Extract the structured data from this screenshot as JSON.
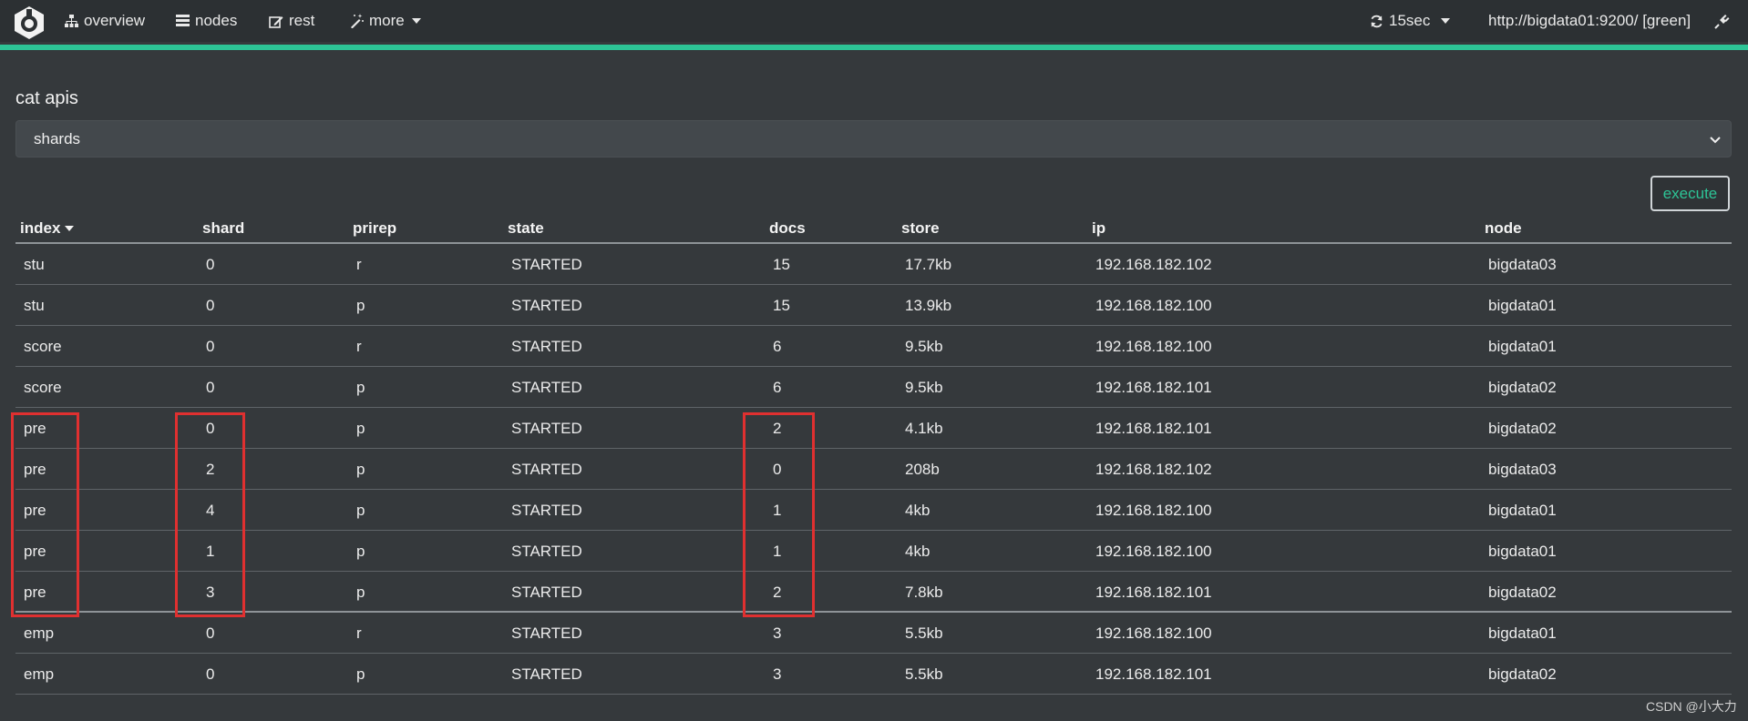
{
  "navbar": {
    "items": [
      {
        "label": "overview",
        "icon": "sitemap-icon"
      },
      {
        "label": "nodes",
        "icon": "list-icon"
      },
      {
        "label": "rest",
        "icon": "edit-icon"
      },
      {
        "label": "more",
        "icon": "magic-wand-icon"
      }
    ],
    "refresh_label": "15sec",
    "cluster_label": "http://bigdata01:9200/ [green]",
    "accent_color": "#2dc496"
  },
  "main": {
    "section_title": "cat apis",
    "api_select_value": "shards",
    "execute_label": "execute"
  },
  "table": {
    "columns": [
      "index",
      "shard",
      "prirep",
      "state",
      "docs",
      "store",
      "ip",
      "node"
    ],
    "rows": [
      [
        "stu",
        "0",
        "r",
        "STARTED",
        "15",
        "17.7kb",
        "192.168.182.102",
        "bigdata03"
      ],
      [
        "stu",
        "0",
        "p",
        "STARTED",
        "15",
        "13.9kb",
        "192.168.182.100",
        "bigdata01"
      ],
      [
        "score",
        "0",
        "r",
        "STARTED",
        "6",
        "9.5kb",
        "192.168.182.100",
        "bigdata01"
      ],
      [
        "score",
        "0",
        "p",
        "STARTED",
        "6",
        "9.5kb",
        "192.168.182.101",
        "bigdata02"
      ],
      [
        "pre",
        "0",
        "p",
        "STARTED",
        "2",
        "4.1kb",
        "192.168.182.101",
        "bigdata02"
      ],
      [
        "pre",
        "2",
        "p",
        "STARTED",
        "0",
        "208b",
        "192.168.182.102",
        "bigdata03"
      ],
      [
        "pre",
        "4",
        "p",
        "STARTED",
        "1",
        "4kb",
        "192.168.182.100",
        "bigdata01"
      ],
      [
        "pre",
        "1",
        "p",
        "STARTED",
        "1",
        "4kb",
        "192.168.182.100",
        "bigdata01"
      ],
      [
        "pre",
        "3",
        "p",
        "STARTED",
        "2",
        "7.8kb",
        "192.168.182.101",
        "bigdata02"
      ],
      [
        "emp",
        "0",
        "r",
        "STARTED",
        "3",
        "5.5kb",
        "192.168.182.100",
        "bigdata01"
      ],
      [
        "emp",
        "0",
        "p",
        "STARTED",
        "3",
        "5.5kb",
        "192.168.182.101",
        "bigdata02"
      ]
    ]
  },
  "highlight_color": "#e03030",
  "watermark": "CSDN @小大力"
}
